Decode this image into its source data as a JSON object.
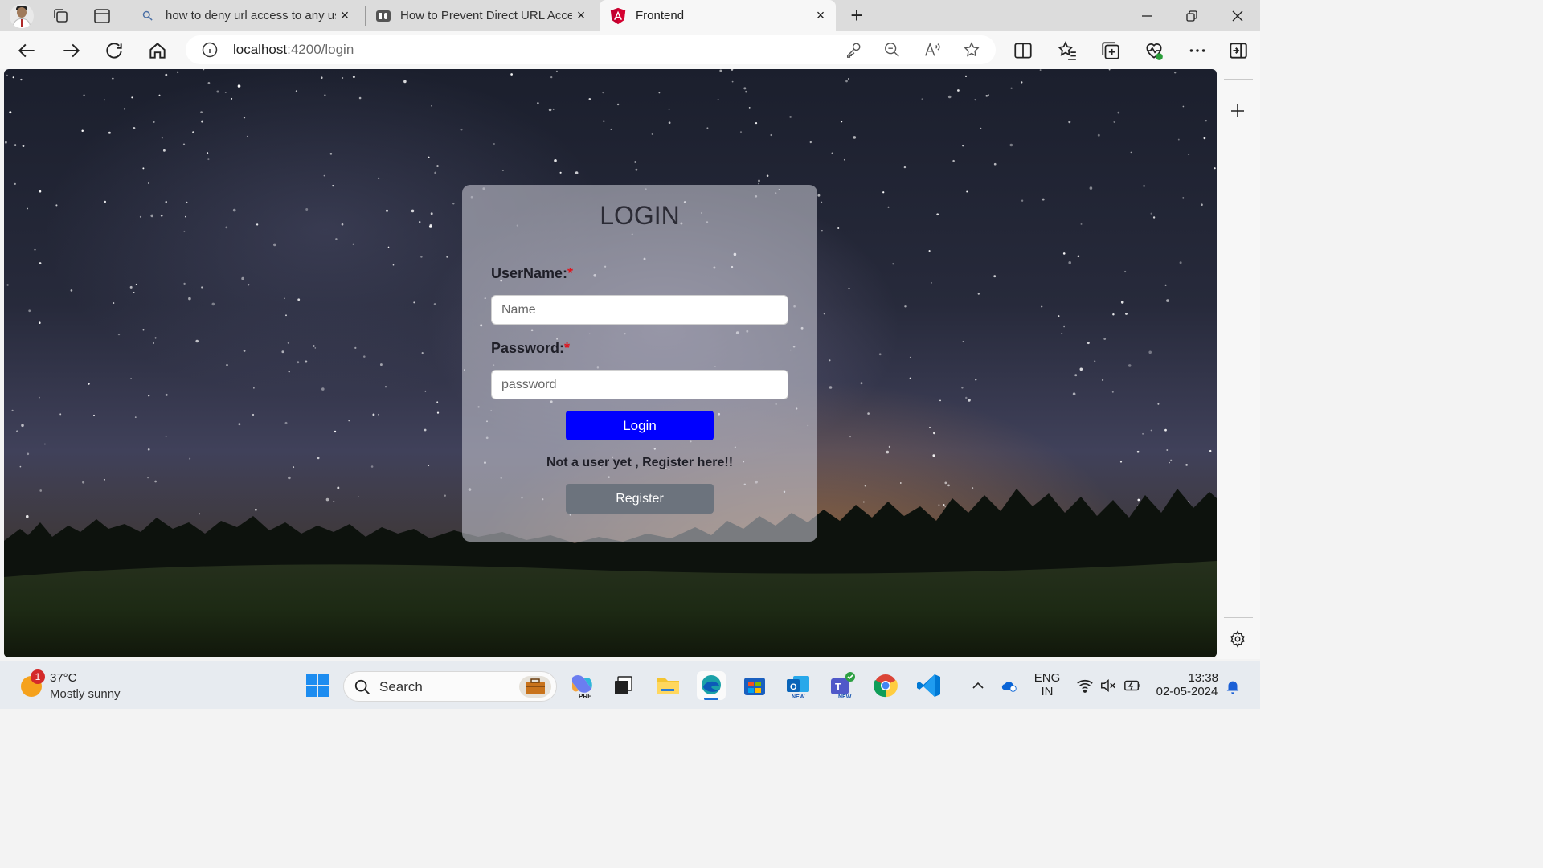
{
  "browser": {
    "tabs": [
      {
        "title": "how to deny url access to any us"
      },
      {
        "title": "How to Prevent Direct URL Acces"
      },
      {
        "title": "Frontend"
      }
    ],
    "address": {
      "host": "localhost",
      "path": ":4200/login"
    }
  },
  "login": {
    "title": "LOGIN",
    "username_label": "UserName:",
    "password_label": "Password:",
    "required_mark": "*",
    "username_placeholder": "Name",
    "password_placeholder": "password",
    "login_button": "Login",
    "register_prompt": "Not a user yet , Register here!!",
    "register_button": "Register"
  },
  "taskbar": {
    "weather_badge": "1",
    "temperature": "37°C",
    "condition": "Mostly sunny",
    "search_label": "Search",
    "language_line1": "ENG",
    "language_line2": "IN",
    "time": "13:38",
    "date": "02-05-2024",
    "new_badge": "NEW",
    "pre_badge": "PRE"
  }
}
